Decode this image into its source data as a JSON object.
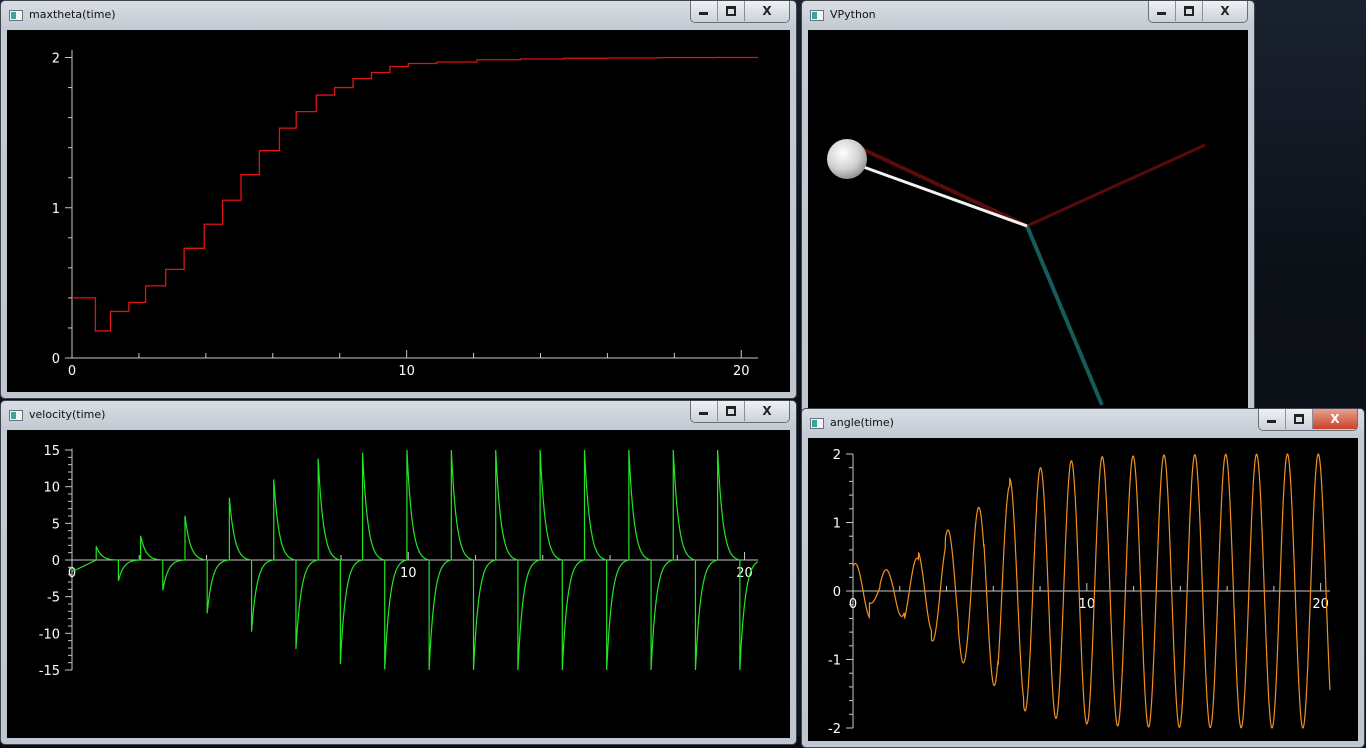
{
  "windows": {
    "maxtheta": {
      "title": "maxtheta(time)"
    },
    "vpython": {
      "title": "VPython"
    },
    "velocity": {
      "title": "velocity(time)"
    },
    "angle": {
      "title": "angle(time)"
    }
  },
  "controls": {
    "minimize": "minimize",
    "maximize": "maximize",
    "close": "X"
  },
  "icons": {
    "app": "app-icon",
    "minimize": "minimize-icon",
    "maximize": "maximize-icon",
    "close": "close-icon"
  },
  "colors": {
    "maxtheta_line": "#e01414",
    "velocity_line": "#22e622",
    "angle_line": "#f09020",
    "rod": "#f2f2f2",
    "axis_red": "#5a0a0a",
    "axis_teal": "#175a5a",
    "bob": "#e8e8e8"
  },
  "chart_data": [
    {
      "type": "line",
      "window": "maxtheta",
      "title": "",
      "xlabel": "",
      "ylabel": "",
      "xlim": [
        0,
        20.5
      ],
      "ylim": [
        0,
        2.05
      ],
      "x_ticks": [
        0,
        10,
        20
      ],
      "y_ticks": [
        0,
        1,
        2
      ],
      "grid": false,
      "step": true,
      "series": [
        {
          "x": [
            0,
            0.7,
            1.15,
            1.7,
            2.2,
            2.8,
            3.35,
            3.95,
            4.5,
            5.05,
            5.6,
            6.2,
            6.7,
            7.3,
            7.85,
            8.4,
            8.95,
            9.5,
            10.05,
            10.9,
            12.1,
            13.4,
            14.7,
            16,
            17.5,
            19.2,
            20.5
          ],
          "y": [
            0.4,
            0.18,
            0.31,
            0.37,
            0.48,
            0.59,
            0.73,
            0.89,
            1.05,
            1.22,
            1.38,
            1.53,
            1.64,
            1.75,
            1.8,
            1.86,
            1.9,
            1.94,
            1.96,
            1.97,
            1.985,
            1.99,
            1.995,
            1.997,
            1.999,
            2.0,
            2.0
          ]
        }
      ]
    },
    {
      "type": "line",
      "window": "velocity",
      "title": "",
      "xlabel": "",
      "ylabel": "",
      "xlim": [
        0,
        20.4
      ],
      "ylim": [
        -15,
        15.2
      ],
      "x_ticks": [
        0,
        10,
        20
      ],
      "y_ticks": [
        -15,
        -10,
        -5,
        0,
        5,
        10,
        15
      ],
      "grid": false,
      "half_period": 0.66,
      "phase_start": 0.72,
      "max_theta_ref": "maxtheta",
      "omega_scale": 7.6
    },
    {
      "type": "line",
      "window": "angle",
      "title": "",
      "xlabel": "",
      "ylabel": "",
      "xlim": [
        0,
        20.4
      ],
      "ylim": [
        -2,
        2
      ],
      "x_ticks": [
        0,
        10,
        20
      ],
      "y_ticks": [
        -2,
        -1,
        0,
        1,
        2
      ],
      "grid": false,
      "half_period": 0.66,
      "phase_start": 0.72,
      "max_theta_ref": "maxtheta"
    }
  ]
}
